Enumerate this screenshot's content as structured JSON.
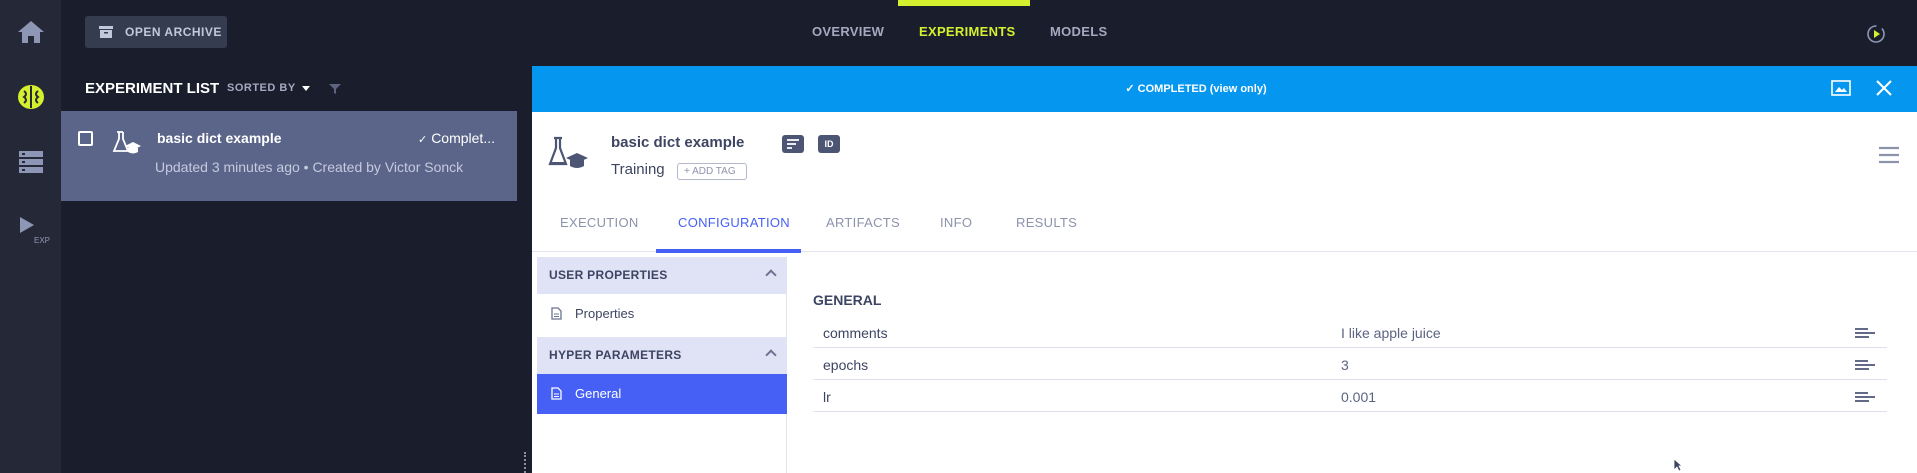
{
  "nav": {
    "rail": [
      {
        "name": "home-icon"
      },
      {
        "name": "brain-icon",
        "active": true
      },
      {
        "name": "datasets-icon"
      },
      {
        "name": "pipeline-icon",
        "label": "EXP"
      }
    ],
    "open_archive": "OPEN ARCHIVE",
    "tabs": [
      {
        "label": "OVERVIEW"
      },
      {
        "label": "EXPERIMENTS",
        "active": true
      },
      {
        "label": "MODELS"
      }
    ]
  },
  "list": {
    "title": "EXPERIMENT LIST",
    "sorted_by": "SORTED BY",
    "rows": [
      {
        "name": "basic dict example",
        "status": "Complet...",
        "meta": "Updated 3 minutes ago • Created by Victor Sonck"
      }
    ]
  },
  "detail": {
    "banner": "COMPLETED (view only)",
    "name": "basic dict example",
    "id_badge": "ID",
    "type": "Training",
    "add_tag": "ADD TAG",
    "tabs": [
      {
        "label": "EXECUTION"
      },
      {
        "label": "CONFIGURATION",
        "active": true
      },
      {
        "label": "ARTIFACTS"
      },
      {
        "label": "INFO"
      },
      {
        "label": "RESULTS"
      }
    ],
    "sections": [
      {
        "title": "USER PROPERTIES",
        "items": [
          {
            "label": "Properties"
          }
        ]
      },
      {
        "title": "HYPER PARAMETERS",
        "items": [
          {
            "label": "General",
            "active": true
          }
        ]
      }
    ],
    "config": {
      "title": "GENERAL",
      "rows": [
        {
          "key": "comments",
          "value": "I like apple juice"
        },
        {
          "key": "epochs",
          "value": "3"
        },
        {
          "key": "lr",
          "value": "0.001"
        }
      ]
    }
  },
  "colors": {
    "accent": "#d4f02e",
    "banner": "#0596ef",
    "primary": "#4660f6",
    "selected_row": "#5b6589"
  }
}
